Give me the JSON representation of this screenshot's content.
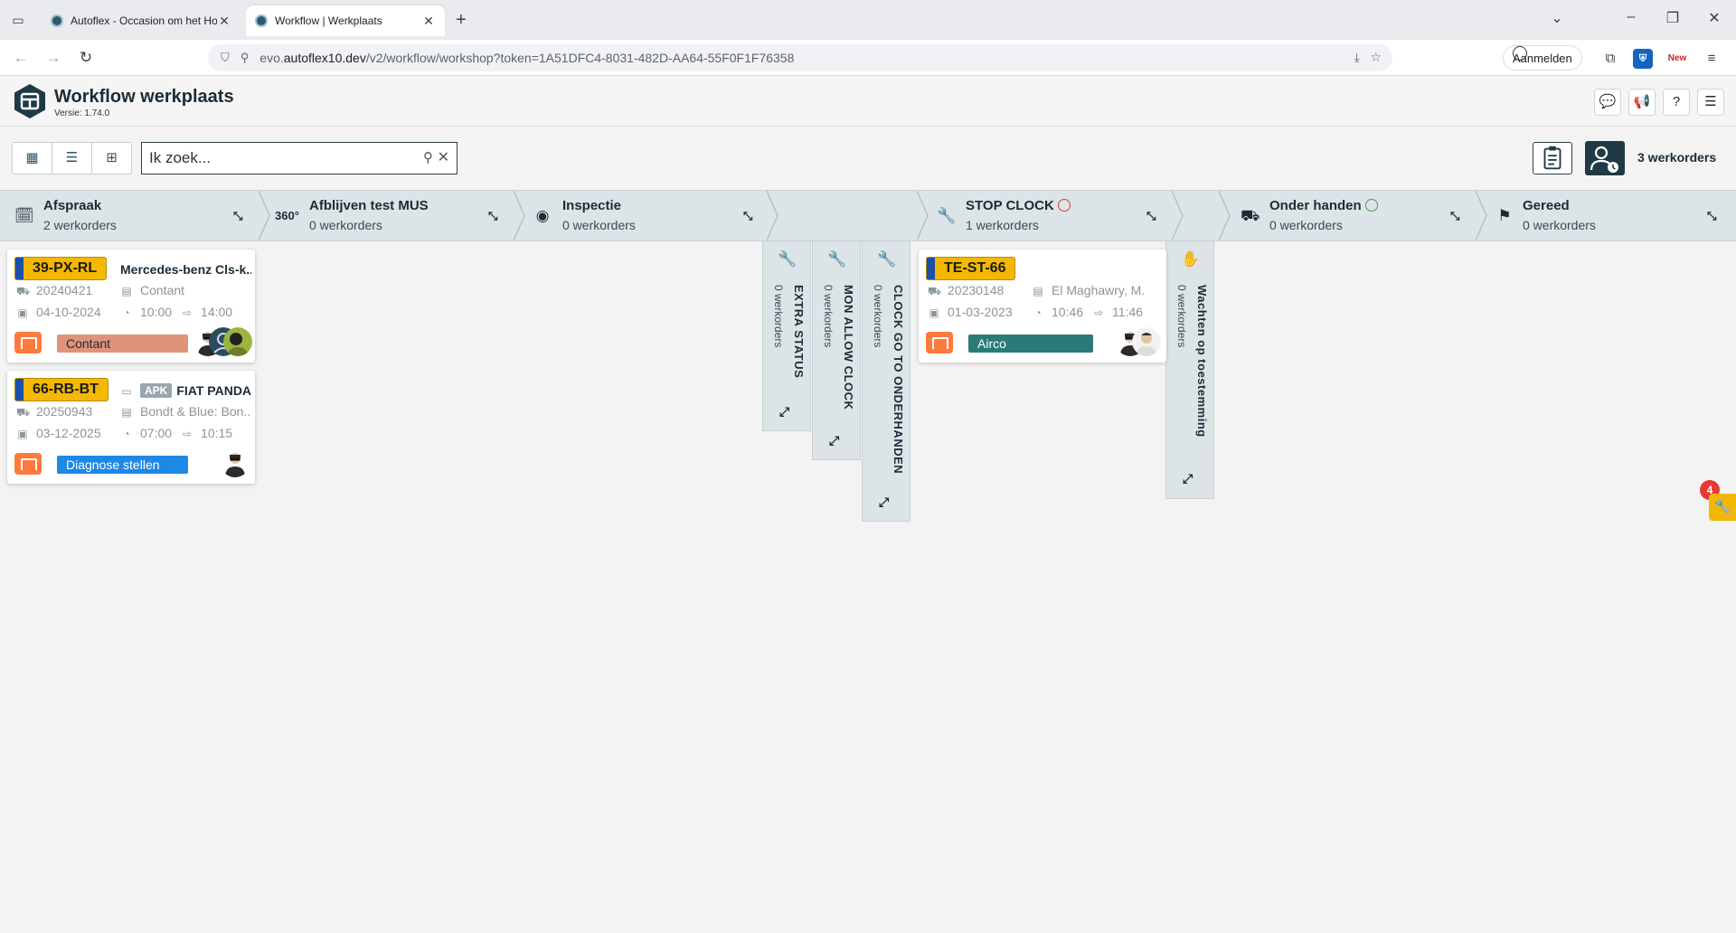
{
  "browser": {
    "tabs": [
      {
        "title": "Autoflex - Occasion om het Hoofd",
        "active": false
      },
      {
        "title": "Workflow | Werkplaats",
        "active": true
      }
    ],
    "url_host": "evo.autoflex10.dev",
    "url_prefix": "evo.",
    "url_domain": "autoflex10.dev",
    "url_path": "/v2/workflow/workshop?token=1A51DFC4-8031-482D-AA64-55F0F1F76358",
    "signin_label": "Aanmelden",
    "ext_badge": "New"
  },
  "app": {
    "title": "Workflow werkplaats",
    "version": "Versie: 1.74.0"
  },
  "toolbar": {
    "search_placeholder": "Ik zoek...",
    "workorder_count": "3 werkorders"
  },
  "columns": [
    {
      "name": "Afspraak",
      "count": "2 werkorders",
      "icon": "calendar-icon"
    },
    {
      "name": "Afblijven test MUS",
      "count": "0 werkorders",
      "icon": "360-icon"
    },
    {
      "name": "Inspectie",
      "count": "0 werkorders",
      "icon": "eye-icon"
    },
    {
      "name": "STOP CLOCK",
      "count": "1 werkorders",
      "icon": "wrench-icon"
    },
    {
      "name": "Onder handen",
      "count": "0 werkorders",
      "icon": "car-lift-icon"
    },
    {
      "name": "Gereed",
      "count": "0 werkorders",
      "icon": "flag-icon"
    }
  ],
  "lanes": [
    {
      "name": "EXTRA STATUS",
      "count": "0 werkorders"
    },
    {
      "name": "MON ALLOW CLOCK",
      "count": "0 werkorders"
    },
    {
      "name": "CLOCK GO TO ONDERHANDEN",
      "count": "0 werkorders"
    },
    {
      "name": "Wachten op toestemming",
      "count": "0 werkorders"
    }
  ],
  "cards": [
    {
      "plate": "39-PX-RL",
      "model": "Mercedes-benz Cls-k...",
      "order_no": "20240421",
      "customer": "Contant",
      "date": "04-10-2024",
      "start": "10:00",
      "end": "14:00",
      "tag": "Contant",
      "tag_color": "#e0937a"
    },
    {
      "plate": "66-RB-BT",
      "apk": "APK",
      "model": "FIAT PANDA",
      "order_no": "20250943",
      "customer": "Bondt & Blue: Bon...",
      "date": "03-12-2025",
      "start": "07:00",
      "end": "10:15",
      "tag": "Diagnose stellen",
      "tag_color": "#1e88e5"
    },
    {
      "plate": "TE-ST-66",
      "model": "",
      "order_no": "20230148",
      "customer": "El Maghawry, M.",
      "date": "01-03-2023",
      "start": "10:46",
      "end": "11:46",
      "tag": "Airco",
      "tag_color": "#2a7a78"
    }
  ],
  "notifications": {
    "count": "4"
  }
}
